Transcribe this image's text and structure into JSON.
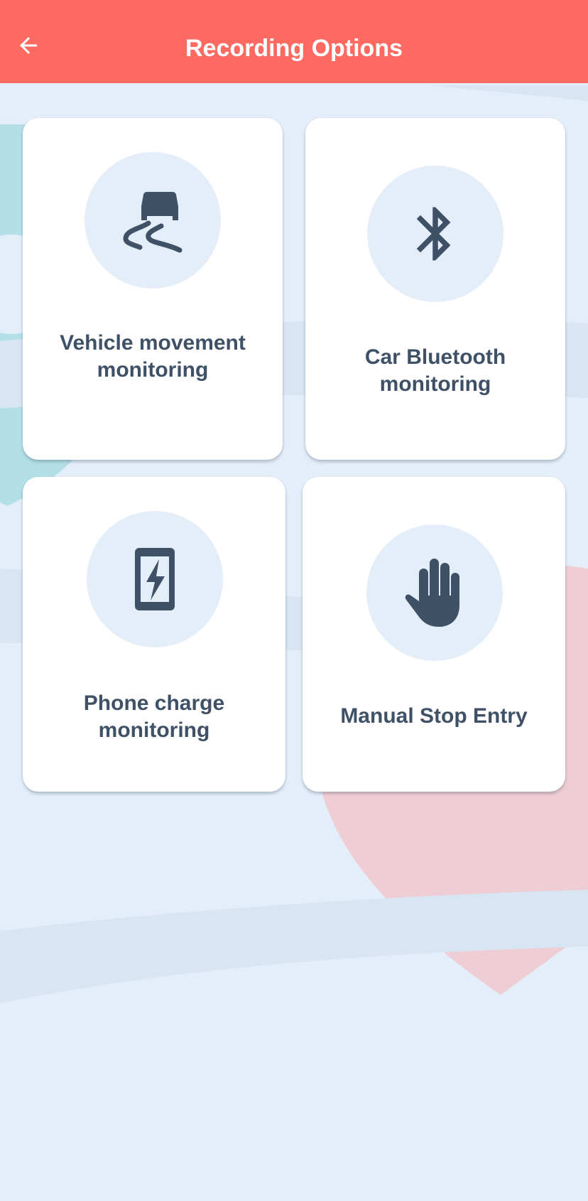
{
  "header": {
    "title": "Recording Options",
    "back_icon": "arrow-back-icon",
    "background": "#fe6962"
  },
  "options": [
    {
      "label": "Vehicle movement monitoring",
      "icon": "car-skid-icon"
    },
    {
      "label": "Car Bluetooth monitoring",
      "icon": "bluetooth-icon"
    },
    {
      "label": "Phone charge monitoring",
      "icon": "phone-charging-icon"
    },
    {
      "label": "Manual Stop Entry",
      "icon": "hand-stop-icon"
    }
  ],
  "colors": {
    "accent": "#fe6962",
    "text": "#3f5166",
    "icon": "#3f5166",
    "background": "#e4eef9",
    "card": "#ffffff"
  }
}
